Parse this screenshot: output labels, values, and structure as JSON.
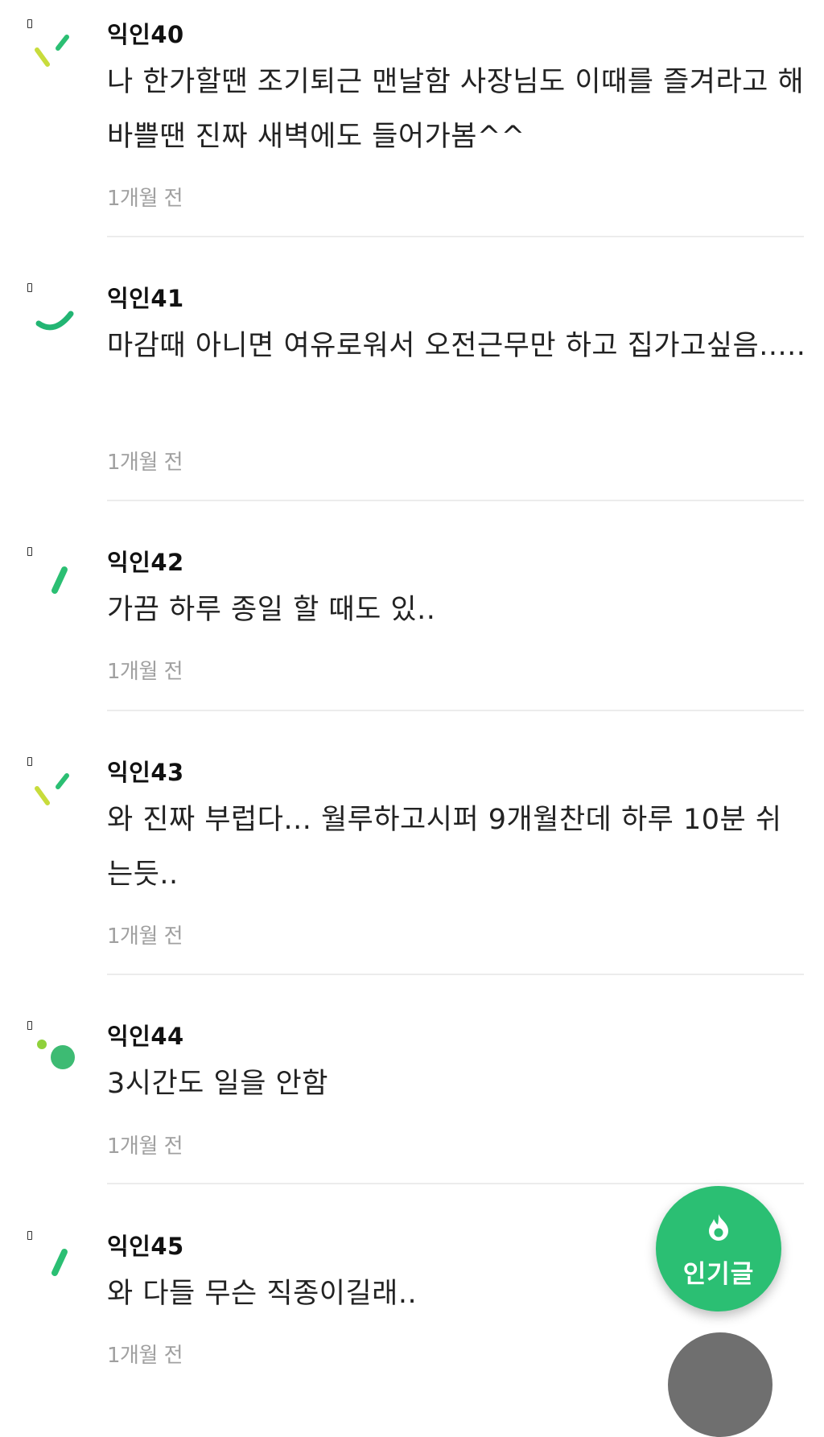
{
  "comments": [
    {
      "author": "익인40",
      "text": "나 한가할땐 조기퇴근 맨날함 사장님도 이때를 즐겨라고 해 바쁠땐 진짜 새벽에도 들어가봄^^",
      "time": "1개월 전",
      "avatar_icon": "two-slash-icon"
    },
    {
      "author": "익인41",
      "text": "마감때 아니면 여유로워서 오전근무만 하고 집가고싶음.....",
      "time": "1개월 전",
      "avatar_icon": "curve-icon"
    },
    {
      "author": "익인42",
      "text": "가끔 하루 종일 할 때도 있..",
      "time": "1개월 전",
      "avatar_icon": "single-slash-icon"
    },
    {
      "author": "익인43",
      "text": "와 진짜 부럽다... 월루하고시퍼 9개월찬데 하루 10분 쉬는듯..",
      "time": "1개월 전",
      "avatar_icon": "two-slash-icon"
    },
    {
      "author": "익인44",
      "text": "3시간도 일을 안함",
      "time": "1개월 전",
      "avatar_icon": "two-dots-icon"
    },
    {
      "author": "익인45",
      "text": "와 다들 무슨 직종이길래..",
      "time": "1개월 전",
      "avatar_icon": "single-slash-icon"
    }
  ],
  "fab": {
    "label": "인기글",
    "icon": "flame-icon",
    "color": "#2bbf73"
  },
  "colors": {
    "lime": "#c8dc3c",
    "green": "#2bbf73",
    "teal": "#22b573",
    "time_gray": "#a0a0a0"
  }
}
